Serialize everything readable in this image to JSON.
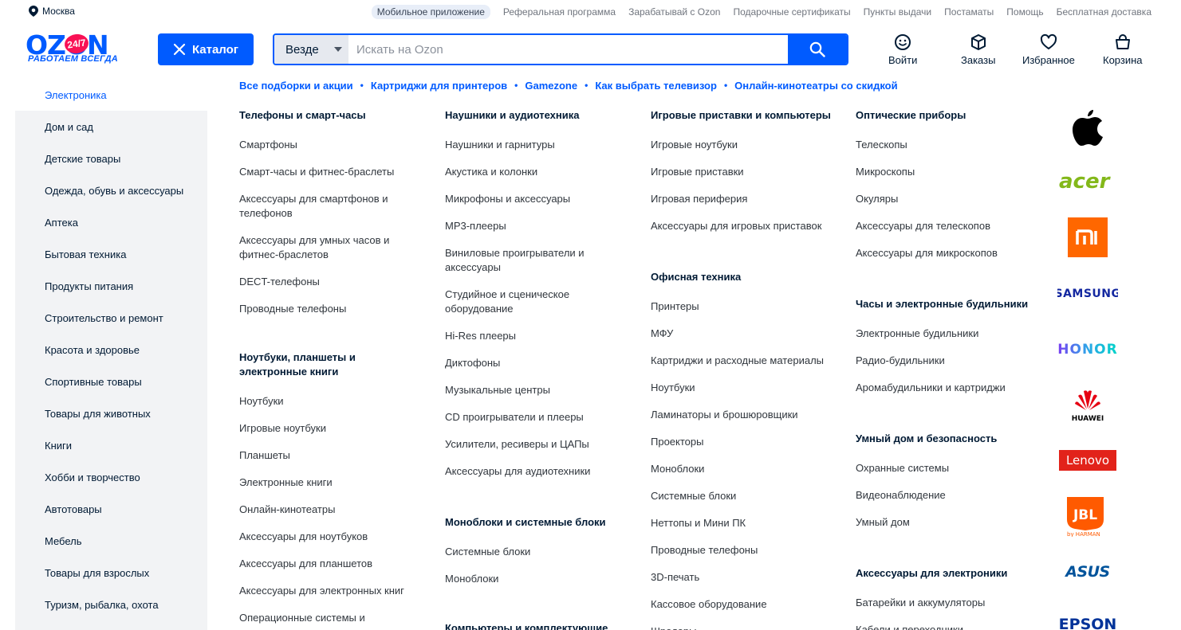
{
  "top": {
    "city": "Москва",
    "links": [
      "Мобильное приложение",
      "Реферальная программа",
      "Зарабатывай с Ozon",
      "Подарочные сертификаты",
      "Пункты выдачи",
      "Постаматы",
      "Помощь",
      "Бесплатная доставка"
    ]
  },
  "header": {
    "logo_text": "OZON",
    "logo_badge": "24/7",
    "logo_slogan": "РАБОТАЕМ ВСЕГДА",
    "catalog_label": "Каталог",
    "search_scope": "Везде",
    "search_placeholder": "Искать на Ozon",
    "actions": {
      "login": "Войти",
      "orders": "Заказы",
      "favorites": "Избранное",
      "cart": "Корзина"
    }
  },
  "sidebar": {
    "items": [
      "Электроника",
      "Дом и сад",
      "Детские товары",
      "Одежда, обувь и аксессуары",
      "Аптека",
      "Бытовая техника",
      "Продукты питания",
      "Строительство и ремонт",
      "Красота и здоровье",
      "Спортивные товары",
      "Товары для животных",
      "Книги",
      "Хобби и творчество",
      "Автотовары",
      "Мебель",
      "Товары для взрослых",
      "Туризм, рыбалка, охота"
    ],
    "active": 0
  },
  "featured": [
    "Все подборки и акции",
    "Картриджи для принтеров",
    "Gamezone",
    "Как выбрать телевизор",
    "Онлайн-кинотеатры со скидкой"
  ],
  "columns": [
    {
      "groups": [
        {
          "title": "Телефоны и смарт-часы",
          "links": [
            "Смартфоны",
            "Смарт-часы и фитнес-браслеты",
            "Аксессуары для смартфонов и\nтелефонов",
            "Аксессуары для умных часов и\nфитнес-браслетов",
            "DECT-телефоны",
            "Проводные телефоны"
          ]
        },
        {
          "title": "Ноутбуки, планшеты и\nэлектронные книги",
          "links": [
            "Ноутбуки",
            "Игровые ноутбуки",
            "Планшеты",
            "Электронные книги",
            "Онлайн-кинотеатры",
            "Аксессуары для ноутбуков",
            "Аксессуары для планшетов",
            "Аксессуары для электронных книг",
            "Операционные системы и"
          ]
        }
      ]
    },
    {
      "groups": [
        {
          "title": "Наушники и аудиотехника",
          "links": [
            "Наушники и гарнитуры",
            "Акустика и колонки",
            "Микрофоны и аксессуары",
            "MP3-плееры",
            "Виниловые проигрыватели и\nаксессуары",
            "Студийное и сценическое\nоборудование",
            "Hi-Res плееры",
            "Диктофоны",
            "Музыкальные центры",
            "CD проигрыватели и плееры",
            "Усилители, ресиверы и ЦАПы",
            "Аксессуары для аудиотехники"
          ]
        },
        {
          "title": "Моноблоки и системные блоки",
          "links": [
            "Системные блоки",
            "Моноблоки"
          ]
        },
        {
          "title": "Компьютеры и комплектующие",
          "links": []
        }
      ]
    },
    {
      "groups": [
        {
          "title": "Игровые приставки и компьютеры",
          "links": [
            "Игровые ноутбуки",
            "Игровые приставки",
            "Игровая периферия",
            "Аксессуары для игровых приставок"
          ]
        },
        {
          "title": "Офисная техника",
          "links": [
            "Принтеры",
            "МФУ",
            "Картриджи и расходные материалы",
            "Ноутбуки",
            "Ламинаторы и брошюровщики",
            "Проекторы",
            "Моноблоки",
            "Системные блоки",
            "Неттопы и Мини ПК",
            "Проводные телефоны",
            "3D-печать",
            "Кассовое оборудование",
            "Шредеры"
          ]
        }
      ]
    },
    {
      "groups": [
        {
          "title": "Оптические приборы",
          "links": [
            "Телескопы",
            "Микроскопы",
            "Окуляры",
            "Аксессуары для телескопов",
            "Аксессуары для микроскопов"
          ]
        },
        {
          "title": "Часы и электронные будильники",
          "links": [
            "Электронные будильники",
            "Радио-будильники",
            "Аромабудильники и картриджи"
          ]
        },
        {
          "title": "Умный дом и безопасность",
          "links": [
            "Охранные системы",
            "Видеонаблюдение",
            "Умный дом"
          ]
        },
        {
          "title": "Аксессуары для электроники",
          "links": [
            "Батарейки и аккумуляторы",
            "Кабели и переходники"
          ]
        }
      ]
    }
  ],
  "brands": [
    "apple",
    "acer",
    "mi",
    "SAMSUNG",
    "HONOR",
    "HUAWEI",
    "Lenovo",
    "JBL",
    "ASUS",
    "EPSON"
  ],
  "colors": {
    "accent": "#005bff",
    "badge": "#f91155",
    "sidebar_bg": "#f2f3f5"
  }
}
